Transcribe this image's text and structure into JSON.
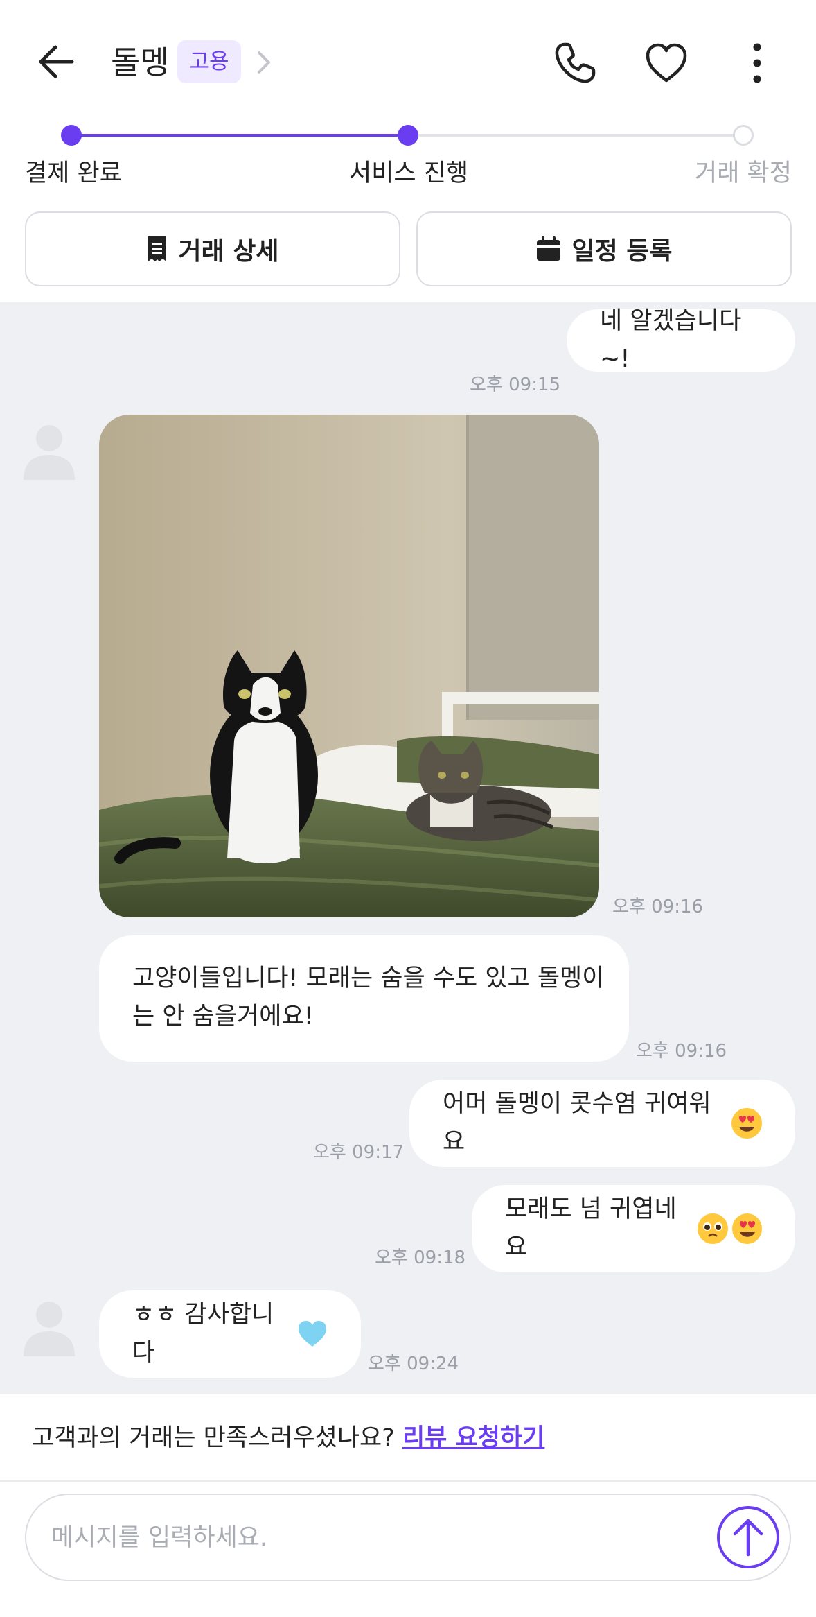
{
  "header": {
    "title": "돌멩",
    "badge": "고용"
  },
  "progress": {
    "steps": [
      {
        "label": "결제 완료",
        "state": "done"
      },
      {
        "label": "서비스 진행",
        "state": "current"
      },
      {
        "label": "거래 확정",
        "state": "pending"
      }
    ]
  },
  "actions": {
    "detail_label": "거래 상세",
    "schedule_label": "일정 등록"
  },
  "messages": [
    {
      "side": "out",
      "text": "네 알겠습니다~!",
      "time": "오후 09:15"
    },
    {
      "side": "in",
      "type": "image",
      "alt_subject": "cats",
      "time": "오후 09:16"
    },
    {
      "side": "in",
      "text_line1": "고양이들입니다! 모래는 숨을 수도 있고 돌멩이",
      "text_line2": "는 안 숨을거에요!",
      "time": "오후 09:16"
    },
    {
      "side": "out",
      "text": "어머 돌멩이 콧수염 귀여워요",
      "emoji": [
        "heart-eyes"
      ],
      "time": "오후 09:17"
    },
    {
      "side": "out",
      "text": "모래도 넘 귀엽네요",
      "emoji": [
        "pleading-face",
        "heart-eyes"
      ],
      "time": "오후 09:18"
    },
    {
      "side": "in",
      "text": "ㅎㅎ 감사합니다",
      "emoji": [
        "light-blue-heart"
      ],
      "time": "오후 09:24"
    }
  ],
  "review": {
    "prompt": "고객과의 거래는 만족스러우셨나요?",
    "link": "리뷰 요청하기"
  },
  "composer": {
    "placeholder": "메시지를 입력하세요."
  },
  "colors": {
    "accent": "#6a3df0",
    "chat_bg": "#eef0f3",
    "muted": "#9b9fa8"
  }
}
